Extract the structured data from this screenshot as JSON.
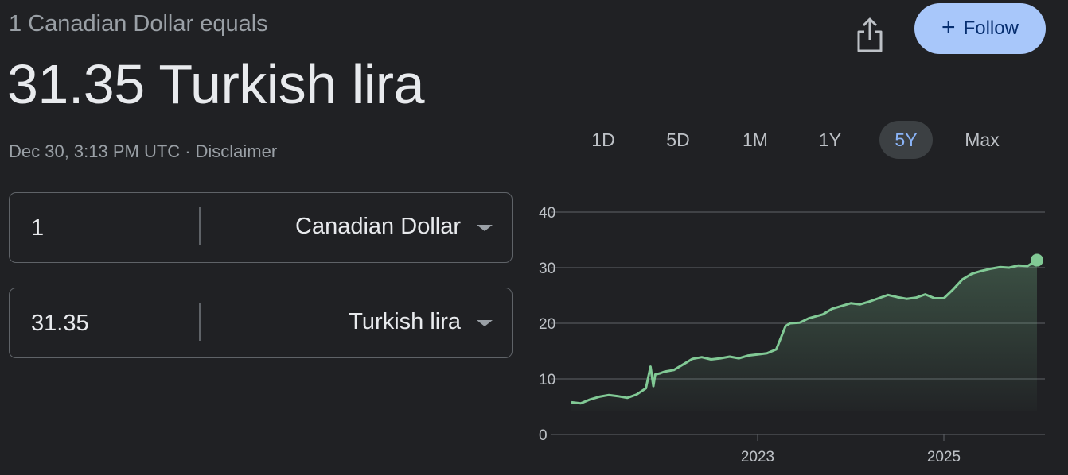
{
  "header": {
    "subtitle": "1 Canadian Dollar equals",
    "result": "31.35 Turkish lira",
    "timestamp": "Dec 30, 3:13 PM UTC",
    "separator": "·",
    "disclaimer": "Disclaimer",
    "share_icon": "share-icon",
    "follow_label": "Follow"
  },
  "converter": {
    "from": {
      "value": "1",
      "currency": "Canadian Dollar"
    },
    "to": {
      "value": "31.35",
      "currency": "Turkish lira"
    }
  },
  "ranges": {
    "items": [
      "1D",
      "5D",
      "1M",
      "1Y",
      "5Y",
      "Max"
    ],
    "active": "5Y"
  },
  "colors": {
    "accent": "#8ab4f8",
    "follow_bg": "#a8c7fa",
    "line": "#81c995",
    "background": "#202124"
  },
  "chart_data": {
    "type": "area",
    "title": "",
    "xlabel": "",
    "ylabel": "",
    "ylim": [
      0,
      40
    ],
    "yticks": [
      0,
      10,
      20,
      30,
      40
    ],
    "xticks": [
      2023,
      2025
    ],
    "xlim": [
      2021.0,
      2026.0
    ],
    "grid": true,
    "series": [
      {
        "x": [
          2021.0,
          2021.1,
          2021.2,
          2021.3,
          2021.4,
          2021.5,
          2021.6,
          2021.7,
          2021.8,
          2021.85,
          2021.88,
          2021.9,
          2021.95,
          2022.0,
          2022.1,
          2022.2,
          2022.3,
          2022.4,
          2022.5,
          2022.6,
          2022.7,
          2022.8,
          2022.9,
          2023.0,
          2023.1,
          2023.2,
          2023.3,
          2023.35,
          2023.45,
          2023.55,
          2023.7,
          2023.8,
          2023.9,
          2024.0,
          2024.1,
          2024.2,
          2024.3,
          2024.4,
          2024.5,
          2024.6,
          2024.7,
          2024.8,
          2024.9,
          2025.0,
          2025.1,
          2025.2,
          2025.3,
          2025.4,
          2025.5,
          2025.6,
          2025.7,
          2025.8,
          2025.9,
          2026.0
        ],
        "values": [
          5.8,
          5.6,
          6.3,
          6.8,
          7.1,
          6.9,
          6.6,
          7.2,
          8.3,
          12.2,
          8.7,
          10.8,
          11.0,
          11.3,
          11.6,
          12.6,
          13.6,
          13.9,
          13.5,
          13.7,
          14.0,
          13.7,
          14.2,
          14.4,
          14.6,
          15.3,
          19.5,
          20.0,
          20.1,
          20.9,
          21.6,
          22.6,
          23.1,
          23.6,
          23.4,
          23.9,
          24.5,
          25.1,
          24.7,
          24.4,
          24.6,
          25.2,
          24.5,
          24.5,
          26.1,
          27.9,
          28.9,
          29.4,
          29.8,
          30.1,
          30.0,
          30.4,
          30.3,
          31.35
        ]
      }
    ]
  }
}
